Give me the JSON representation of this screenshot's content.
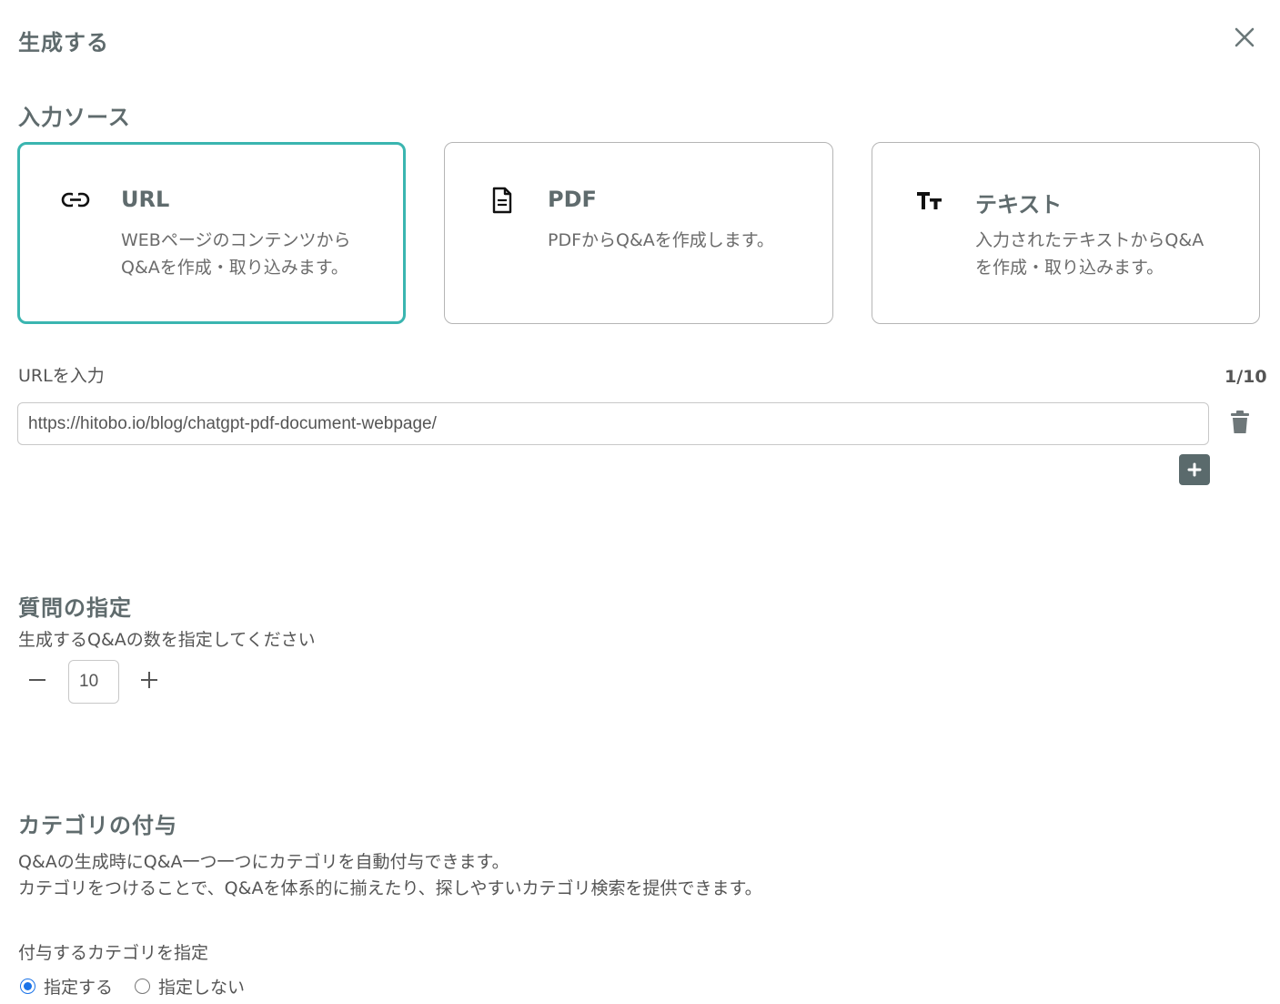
{
  "dialog": {
    "title": "生成する",
    "close_icon": "close-icon"
  },
  "source": {
    "heading": "入力ソース",
    "cards": [
      {
        "icon": "link-icon",
        "title": "URL",
        "desc_line1": "WEBページのコンテンツから",
        "desc_line2": "Q&Aを作成・取り込みます。",
        "selected": true
      },
      {
        "icon": "document-icon",
        "title": "PDF",
        "desc_line1": "PDFからQ&Aを作成します。",
        "desc_line2": "",
        "selected": false
      },
      {
        "icon": "text-size-icon",
        "title": "テキスト",
        "desc_line1": "入力されたテキストからQ&A",
        "desc_line2": "を作成・取り込みます。",
        "selected": false
      }
    ],
    "accent_color": "#3ab5b0"
  },
  "url_section": {
    "label": "URLを入力",
    "counter": "1/10",
    "url_value": "https://hitobo.io/blog/chatgpt-pdf-document-webpage/",
    "delete_icon": "trash-icon",
    "add_icon": "plus-icon"
  },
  "questions": {
    "heading": "質問の指定",
    "instruction": "生成するQ&Aの数を指定してください",
    "count": "10",
    "minus_icon": "minus-icon",
    "plus_icon": "plus-icon"
  },
  "category": {
    "heading": "カテゴリの付与",
    "desc_line1": "Q&Aの生成時にQ&A一つ一つにカテゴリを自動付与できます。",
    "desc_line2": "カテゴリをつけることで、Q&Aを体系的に揃えたり、探しやすいカテゴリ検索を提供できます。",
    "assign_label": "付与するカテゴリを指定",
    "options": [
      {
        "label": "指定する",
        "checked": true
      },
      {
        "label": "指定しない",
        "checked": false
      }
    ]
  }
}
